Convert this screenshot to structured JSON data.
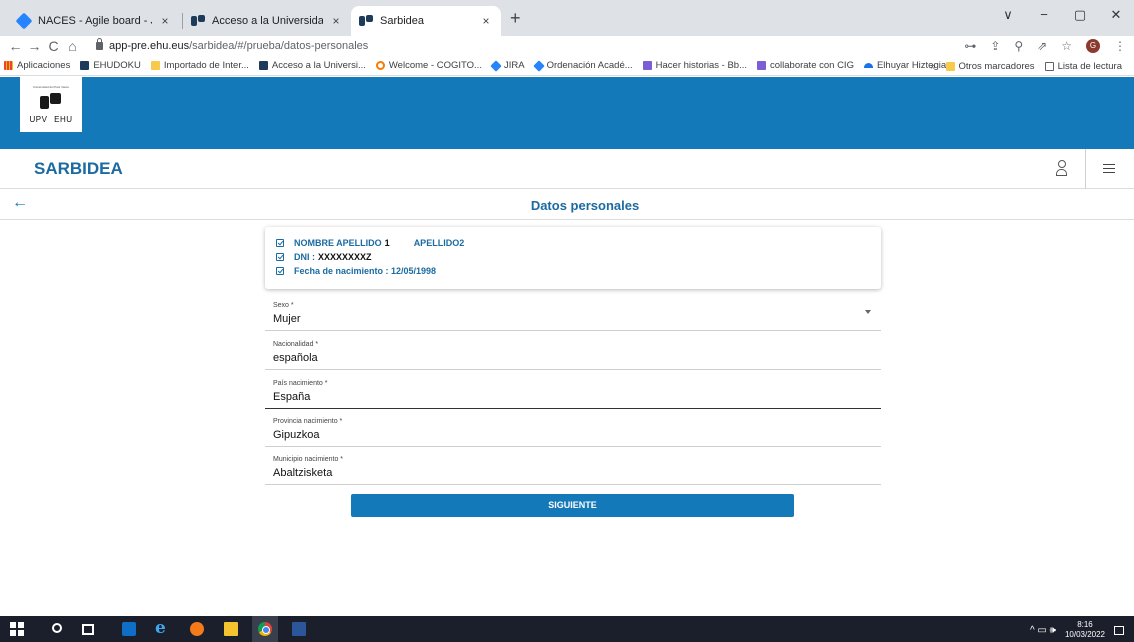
{
  "browser": {
    "tabs": [
      {
        "title": "NACES - Agile board - Jira",
        "close": "×"
      },
      {
        "title": "Acceso a la Universidad - UPV/EHU",
        "close": "×"
      },
      {
        "title": "Sarbidea",
        "close": "×"
      }
    ],
    "new_tab": "+",
    "window_controls": {
      "minimize": "∨",
      "restore_down": "−",
      "maximize": "▢",
      "close": "✕"
    },
    "nav": {
      "back": "←",
      "forward": "→",
      "reload": "C",
      "home": "⌂"
    },
    "url_host": "app-pre.ehu.eus",
    "url_path": "/sarbidea/#/prueba/datos-personales",
    "toolbar_icons": {
      "key": "⊶",
      "share": "⇪",
      "zoom": "⚲",
      "send": "⇗",
      "star": "☆",
      "more": "⋮"
    },
    "profile_initial": "G",
    "bookmarks": [
      {
        "label": "Aplicaciones",
        "icon": "apps-grid-icon"
      },
      {
        "label": "EHUDOKU",
        "icon": "upv-icon"
      },
      {
        "label": "Importado de Inter...",
        "icon": "folder-icon"
      },
      {
        "label": "Acceso a la Universi...",
        "icon": "upv-icon"
      },
      {
        "label": "Welcome - COGITO...",
        "icon": "cogito-icon"
      },
      {
        "label": "JIRA",
        "icon": "jira-icon"
      },
      {
        "label": "Ordenación Acadé...",
        "icon": "jira-icon"
      },
      {
        "label": "Hacer historias - Bb...",
        "icon": "purple-icon"
      },
      {
        "label": "collaborate con CIG",
        "icon": "purple-icon"
      },
      {
        "label": "Elhuyar Hiztegia",
        "icon": "boat-icon"
      }
    ],
    "bookmarks_more": "»",
    "other_bookmarks": "Otros marcadores",
    "reading_list": "Lista de lectura"
  },
  "app": {
    "logo_text": "UPV  EHU",
    "logo_subtext": "Universidad del País Vasco",
    "title": "SARBIDEA",
    "back_icon": "←",
    "page_title": "Datos personales",
    "summary": {
      "name": "NOMBRE APELLIDO",
      "name_suffix": "1",
      "surname2": "APELLIDO2",
      "dni_label": "DNI :",
      "dni_value": "XXXXXXXXZ",
      "birth_label": "Fecha de nacimiento : 12/05/1998"
    },
    "fields": [
      {
        "label": "Sexo *",
        "value": "Mujer"
      },
      {
        "label": "Nacionalidad *",
        "value": "española"
      },
      {
        "label": "País nacimiento *",
        "value": "España"
      },
      {
        "label": "Provincia nacimiento *",
        "value": "Gipuzkoa"
      },
      {
        "label": "Municipio nacimiento *",
        "value": "Abaltzisketa"
      }
    ],
    "next_button": "SIGUIENTE"
  },
  "taskbar": {
    "time": "8:16",
    "date": "10/03/2022",
    "ie_glyph": "e",
    "tray_icons": "^  ▭  🕪"
  }
}
